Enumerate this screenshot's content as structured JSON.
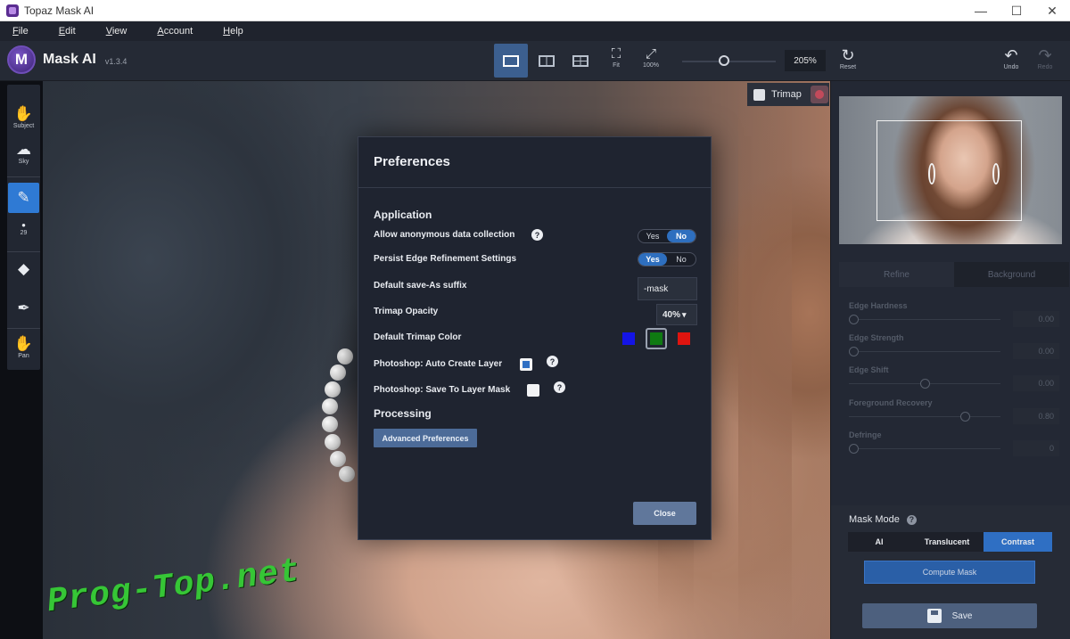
{
  "window": {
    "title": "Topaz Mask AI",
    "minimize": "—",
    "maximize": "☐",
    "close": "✕"
  },
  "menu": [
    "File",
    "Edit",
    "View",
    "Account",
    "Help"
  ],
  "brand": {
    "logo_letter": "M",
    "name": "Mask AI",
    "version": "v1.3.4"
  },
  "toolbar": {
    "view_modes": [
      "single-view",
      "split-view",
      "side-by-side-view"
    ],
    "fit_label": "Fit",
    "zoom100_label": "100%",
    "zoom_value": "205%",
    "reset_label": "Reset",
    "undo_label": "Undo",
    "redo_label": "Redo"
  },
  "left_tools": {
    "subject_label": "Subject",
    "sky_label": "Sky",
    "brush_size": "29",
    "pan_label": "Pan"
  },
  "canvas": {
    "watermark": "Prog-Top.net"
  },
  "trimap": {
    "label": "Trimap",
    "checked": false
  },
  "right_panel": {
    "tabs": [
      "Refine",
      "Background"
    ],
    "params": [
      {
        "label": "Edge Hardness",
        "value": "0.00",
        "level": 0.0
      },
      {
        "label": "Edge Strength",
        "value": "0.00",
        "level": 0.0
      },
      {
        "label": "Edge Shift",
        "value": "0.00",
        "level": 0.5
      },
      {
        "label": "Foreground Recovery",
        "value": "0.80",
        "level": 0.8
      },
      {
        "label": "Defringe",
        "value": "0",
        "level": 0.0
      }
    ],
    "mask_mode": {
      "title": "Mask Mode",
      "help": "?",
      "options": [
        "AI",
        "Translucent",
        "Contrast"
      ],
      "selected": "Contrast"
    },
    "compute_label": "Compute Mask",
    "save_label": "Save"
  },
  "dialog": {
    "title": "Preferences",
    "application_heading": "Application",
    "anon_label": "Allow anonymous data collection",
    "anon_yes": "Yes",
    "anon_no": "No",
    "anon_selected": "No",
    "persist_label": "Persist Edge Refinement Settings",
    "persist_yes": "Yes",
    "persist_no": "No",
    "persist_selected": "Yes",
    "suffix_label": "Default save-As suffix",
    "suffix_value": "-mask",
    "opacity_label": "Trimap Opacity",
    "opacity_value": "40%",
    "color_label": "Default Trimap Color",
    "colors": [
      "#1414e6",
      "#0f7a12",
      "#e0140f"
    ],
    "selected_color": "#0f7a12",
    "ps_layer_label": "Photoshop: Auto Create Layer",
    "ps_layer_checked": true,
    "ps_mask_label": "Photoshop: Save To Layer Mask",
    "ps_mask_checked": false,
    "processing_heading": "Processing",
    "advanced_label": "Advanced Preferences",
    "close_label": "Close",
    "help": "?"
  }
}
